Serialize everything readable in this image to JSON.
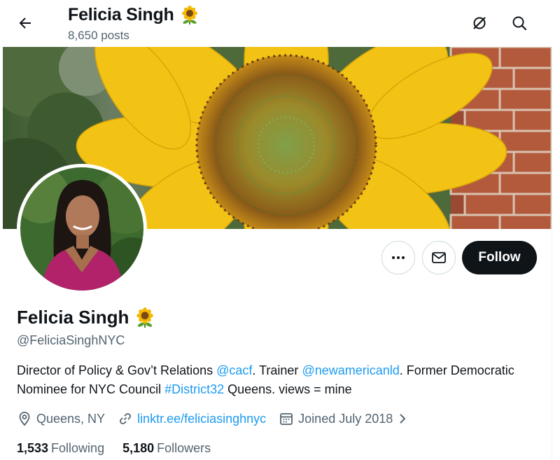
{
  "header": {
    "name": "Felicia Singh",
    "posts": "8,650 posts",
    "back_icon": "arrow-left-icon",
    "icons": [
      "grok-slash-icon",
      "search-icon"
    ]
  },
  "profile": {
    "name": "Felicia Singh",
    "badge_icon": "sunflower-emoji",
    "handle": "@FeliciaSinghNYC",
    "bio": {
      "p1": "Director of Policy & Gov’t Relations ",
      "mention1": "@cacf",
      "p2": ". Trainer ",
      "mention2": "@newamericanld",
      "p3": ". Former Democratic Nominee for NYC Council ",
      "hashtag": "#District32",
      "p4": " Queens. views = mine"
    },
    "location": "Queens, NY",
    "website": "linktr.ee/feliciasinghnyc",
    "joined": "Joined July 2018"
  },
  "actions": {
    "more_icon": "more-dots-icon",
    "message_icon": "envelope-icon",
    "follow_label": "Follow"
  },
  "stats": {
    "following_count": "1,533",
    "following_label": "Following",
    "followers_count": "5,180",
    "followers_label": "Followers"
  },
  "colors": {
    "text": "#0f1419",
    "secondary": "#536471",
    "link": "#1d9bf0",
    "follow_bg": "#0f1419"
  }
}
